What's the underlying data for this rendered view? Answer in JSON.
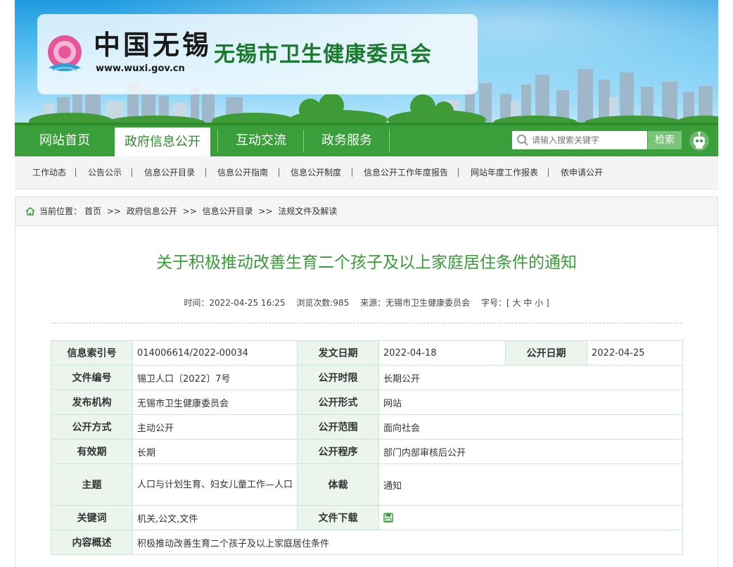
{
  "header": {
    "logo_text": "中国无锡",
    "logo_url": "www.wuxi.gov.cn",
    "site_name": "无锡市卫生健康委员会"
  },
  "nav": {
    "items": [
      {
        "label": "网站首页",
        "active": false
      },
      {
        "label": "政府信息公开",
        "active": true
      },
      {
        "label": "互动交流",
        "active": false
      },
      {
        "label": "政务服务",
        "active": false
      }
    ],
    "search_placeholder": "请输入搜索关键字",
    "search_button": "检索"
  },
  "subnav": {
    "items": [
      "工作动态",
      "公告公示",
      "信息公开目录",
      "信息公开指南",
      "信息公开制度",
      "信息公开工作年度报告",
      "网站年度工作报表",
      "依申请公开"
    ]
  },
  "breadcrumb": {
    "prefix": "当前位置：",
    "items": [
      "首页",
      "政府信息公开",
      "信息公开目录",
      "法规文件及解读"
    ],
    "separator": ">>"
  },
  "article": {
    "title": "关于积极推动改善生育二个孩子及以上家庭居住条件的通知",
    "time_label": "时间：",
    "time": "2022-04-25 16:25",
    "views_label": "浏览次数:",
    "views": "985",
    "source_label": "来源：",
    "source": "无锡市卫生健康委员会",
    "fontsize_label": "字号：",
    "fontsize_options": "[ 大 中 小 ]"
  },
  "info_table": {
    "index_no_label": "信息索引号",
    "index_no": "014006614/2022-00034",
    "issue_date_label": "发文日期",
    "issue_date": "2022-04-18",
    "publish_date_label": "公开日期",
    "publish_date": "2022-04-25",
    "doc_no_label": "文件编号",
    "doc_no": "锡卫人口〔2022〕7号",
    "period_label": "公开时限",
    "period": "长期公开",
    "org_label": "发布机构",
    "org": "无锡市卫生健康委员会",
    "form_label": "公开形式",
    "form": "网站",
    "method_label": "公开方式",
    "method": "主动公开",
    "scope_label": "公开范围",
    "scope": "面向社会",
    "validity_label": "有效期",
    "validity": "长期",
    "procedure_label": "公开程序",
    "procedure": "部门内部审核后公开",
    "topic_label": "主题",
    "topic": "人口与计划生育、妇女儿童工作—人口",
    "genre_label": "体裁",
    "genre": "通知",
    "keywords_label": "关键词",
    "keywords": "机关,公文,文件",
    "download_label": "文件下载",
    "summary_label": "内容概述",
    "summary": "积极推动改善生育二个孩子及以上家庭居住条件"
  },
  "colors": {
    "brand_green": "#3a9e3a",
    "title_green": "#3a9a3a",
    "table_key_bg": "#ebf5ee"
  },
  "icons": [
    "search-icon",
    "robot-assistant-icon",
    "home-icon",
    "save-file-icon"
  ]
}
